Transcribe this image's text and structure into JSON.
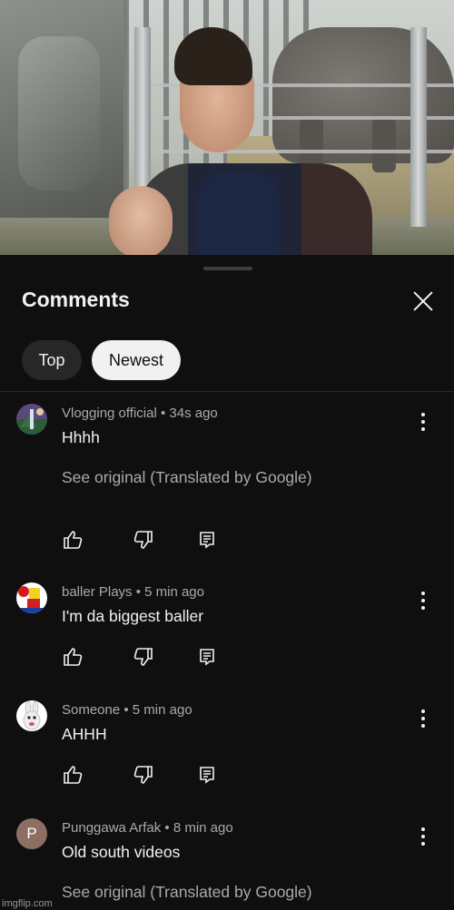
{
  "panel": {
    "title": "Comments",
    "filters": [
      {
        "label": "Top",
        "selected": false
      },
      {
        "label": "Newest",
        "selected": true
      }
    ]
  },
  "comments": [
    {
      "author": "Vlogging official",
      "time": "34s ago",
      "meta": "Vlogging official • 34s ago",
      "text": "Hhhh",
      "translation_note": "See original (Translated by Google)",
      "avatar_icon": "landscape-avatar"
    },
    {
      "author": "baller Plays",
      "time": "5 min ago",
      "meta": "baller Plays • 5 min ago",
      "text": "I'm da biggest baller",
      "avatar_icon": "roblox-avatar"
    },
    {
      "author": "Someone",
      "time": "5 min ago",
      "meta": "Someone • 5 min ago",
      "text": "AHHH",
      "avatar_icon": "rabbid-avatar"
    },
    {
      "author": "Punggawa Arfak",
      "time": "8 min ago",
      "meta": "Punggawa Arfak • 8 min ago",
      "text": "Old south videos",
      "translation_note": "See original (Translated by Google)",
      "avatar_letter": "P",
      "avatar_color": "#8d6e63"
    }
  ],
  "watermark": "imgflip.com",
  "colors": {
    "background": "#0f0f0f",
    "secondary_text": "#aaaaaa",
    "chip_selected": "#f1f1f1",
    "chip_unselected": "#272727"
  }
}
